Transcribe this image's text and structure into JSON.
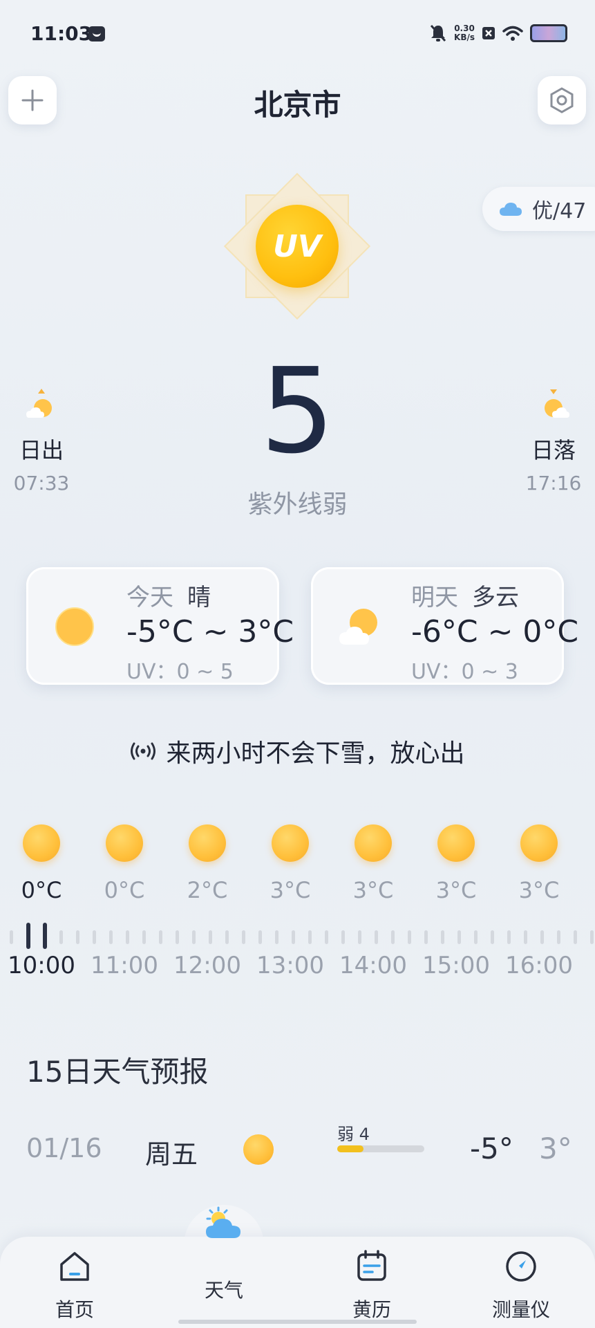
{
  "status_bar": {
    "time": "11:03",
    "net_speed_value": "0.30",
    "net_speed_unit": "KB/s"
  },
  "header": {
    "city": "北京市",
    "add_icon": "plus-icon",
    "settings_icon": "settings-hex-icon"
  },
  "aqi": {
    "text": "优/47",
    "icon": "cloud-icon"
  },
  "uv": {
    "badge_label": "UV",
    "value": "5",
    "level": "紫外线弱"
  },
  "sunrise": {
    "label": "日出",
    "time": "07:33",
    "icon": "sunrise-icon"
  },
  "sunset": {
    "label": "日落",
    "time": "17:16",
    "icon": "sunset-icon"
  },
  "days": {
    "today": {
      "day": "今天",
      "condition": "晴",
      "temp": "-5°C ~ 3°C",
      "uv": "UV：0 ~ 5",
      "icon": "sunny-icon"
    },
    "tomorrow": {
      "day": "明天",
      "condition": "多云",
      "temp": "-6°C ~ 0°C",
      "uv": "UV：0 ~ 3",
      "icon": "partly-cloudy-icon"
    }
  },
  "notice": {
    "text": "来两小时不会下雪，放心出",
    "icon": "broadcast-icon"
  },
  "hourly": [
    {
      "temp": "0°C",
      "time": "10:00",
      "active": true
    },
    {
      "temp": "0°C",
      "time": "11:00"
    },
    {
      "temp": "2°C",
      "time": "12:00"
    },
    {
      "temp": "3°C",
      "time": "13:00"
    },
    {
      "temp": "3°C",
      "time": "14:00"
    },
    {
      "temp": "3°C",
      "time": "15:00"
    },
    {
      "temp": "3°C",
      "time": "16:00"
    }
  ],
  "forecast": {
    "title": "15日天气预报",
    "rows": [
      {
        "date": "01/16",
        "weekday": "周五",
        "uv_label": "弱 4",
        "uv_fraction": 0.3,
        "low": "-5°",
        "high": "3°"
      }
    ]
  },
  "nav": {
    "items": [
      {
        "label": "首页",
        "icon": "home-icon"
      },
      {
        "label": "天气",
        "icon": "weather-cloud-icon",
        "active": true
      },
      {
        "label": "黄历",
        "icon": "calendar-icon"
      },
      {
        "label": "测量仪",
        "icon": "compass-icon"
      }
    ]
  },
  "colors": {
    "accent_sun": "#ffbf0f",
    "uv_bar": "#f2c01e",
    "primary_text": "#1f2433",
    "secondary_text": "#9aa1ad"
  }
}
